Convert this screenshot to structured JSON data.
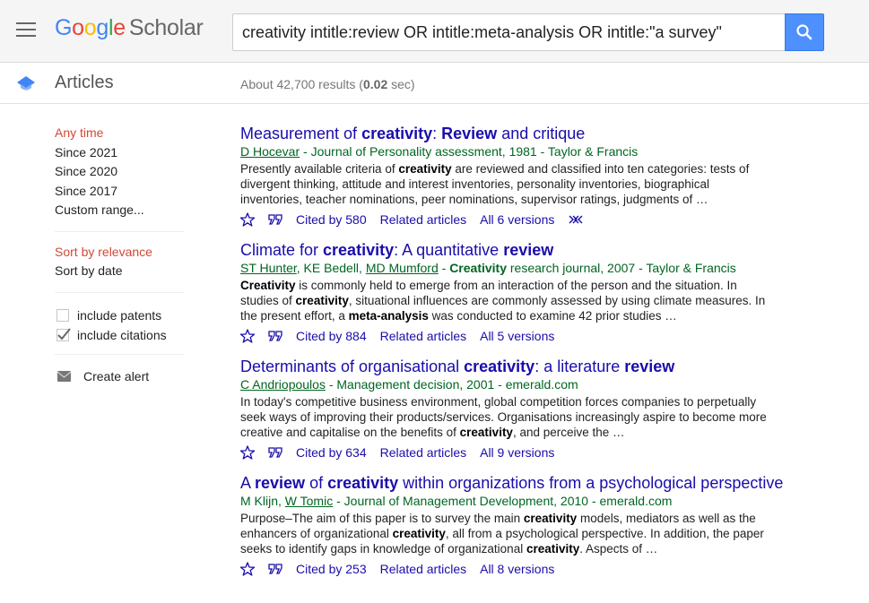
{
  "header": {
    "logo": {
      "google": [
        "G",
        "o",
        "o",
        "g",
        "l",
        "e"
      ],
      "product": "Scholar"
    },
    "search_query": "creativity intitle:review OR intitle:meta-analysis OR intitle:\"a survey\"",
    "search_button_icon": "search-icon",
    "menu_icon": "hamburger-menu-icon"
  },
  "subheader": {
    "section_icon": "graduation-cap-icon",
    "section_label": "Articles",
    "stats_prefix": "About 42,700 results (",
    "stats_time": "0.02",
    "stats_suffix": " sec)"
  },
  "sidebar": {
    "time_filters": [
      {
        "label": "Any time",
        "active": true
      },
      {
        "label": "Since 2021",
        "active": false
      },
      {
        "label": "Since 2020",
        "active": false
      },
      {
        "label": "Since 2017",
        "active": false
      },
      {
        "label": "Custom range...",
        "active": false
      }
    ],
    "sort_options": [
      {
        "label": "Sort by relevance",
        "active": true
      },
      {
        "label": "Sort by date",
        "active": false
      }
    ],
    "checkboxes": [
      {
        "label": "include patents",
        "checked": false
      },
      {
        "label": "include citations",
        "checked": true
      }
    ],
    "create_alert": {
      "label": "Create alert",
      "icon": "envelope-icon"
    }
  },
  "results": [
    {
      "title_parts": [
        {
          "text": "Measurement of ",
          "bold": false
        },
        {
          "text": "creativity",
          "bold": true
        },
        {
          "text": ": ",
          "bold": false
        },
        {
          "text": "Review",
          "bold": true
        },
        {
          "text": " and critique",
          "bold": false
        }
      ],
      "meta_parts": [
        {
          "text": "D Hocevar",
          "link": true
        },
        {
          "text": " - Journal of Personality assessment, 1981 - Taylor & Francis",
          "link": false
        }
      ],
      "snippet_parts": [
        {
          "text": "Presently available criteria of ",
          "bold": false
        },
        {
          "text": "creativity",
          "bold": true
        },
        {
          "text": " are reviewed and classified into ten categories: tests of divergent thinking, attitude and interest inventories, personality inventories, biographical inventories, teacher nominations, peer nominations, supervisor ratings, judgments of …",
          "bold": false
        }
      ],
      "cited_by": "Cited by 580",
      "related": "Related articles",
      "versions": "All 6 versions",
      "has_more": true
    },
    {
      "title_parts": [
        {
          "text": "Climate for ",
          "bold": false
        },
        {
          "text": "creativity",
          "bold": true
        },
        {
          "text": ": A quantitative ",
          "bold": false
        },
        {
          "text": "review",
          "bold": true
        }
      ],
      "meta_parts": [
        {
          "text": "ST Hunter",
          "link": true
        },
        {
          "text": ", KE Bedell, ",
          "link": false
        },
        {
          "text": "MD Mumford",
          "link": true
        },
        {
          "text": " - ",
          "link": false
        },
        {
          "text": "Creativity",
          "link": false,
          "bold": true
        },
        {
          "text": " research journal, 2007 - Taylor & Francis",
          "link": false
        }
      ],
      "snippet_parts": [
        {
          "text": "Creativity",
          "bold": true
        },
        {
          "text": " is commonly held to emerge from an interaction of the person and the situation. In studies of ",
          "bold": false
        },
        {
          "text": "creativity",
          "bold": true
        },
        {
          "text": ", situational influences are commonly assessed by using climate measures. In the present effort, a ",
          "bold": false
        },
        {
          "text": "meta-analysis",
          "bold": true
        },
        {
          "text": " was conducted to examine 42 prior studies …",
          "bold": false
        }
      ],
      "cited_by": "Cited by 884",
      "related": "Related articles",
      "versions": "All 5 versions",
      "has_more": false
    },
    {
      "title_parts": [
        {
          "text": "Determinants of organisational ",
          "bold": false
        },
        {
          "text": "creativity",
          "bold": true
        },
        {
          "text": ": a literature ",
          "bold": false
        },
        {
          "text": "review",
          "bold": true
        }
      ],
      "meta_parts": [
        {
          "text": "C Andriopoulos",
          "link": true
        },
        {
          "text": " - Management decision, 2001 - emerald.com",
          "link": false
        }
      ],
      "snippet_parts": [
        {
          "text": "In today's competitive business environment, global competition forces companies to perpetually seek ways of improving their products/services. Organisations increasingly aspire to become more creative and capitalise on the benefits of ",
          "bold": false
        },
        {
          "text": "creativity",
          "bold": true
        },
        {
          "text": ", and perceive the …",
          "bold": false
        }
      ],
      "cited_by": "Cited by 634",
      "related": "Related articles",
      "versions": "All 9 versions",
      "has_more": false
    },
    {
      "title_parts": [
        {
          "text": "A ",
          "bold": false
        },
        {
          "text": "review",
          "bold": true
        },
        {
          "text": " of ",
          "bold": false
        },
        {
          "text": "creativity",
          "bold": true
        },
        {
          "text": " within organizations from a psychological perspective",
          "bold": false
        }
      ],
      "meta_parts": [
        {
          "text": "M Klijn, ",
          "link": false
        },
        {
          "text": "W Tomic",
          "link": true
        },
        {
          "text": " - Journal of Management Development, 2010 - emerald.com",
          "link": false
        }
      ],
      "snippet_parts": [
        {
          "text": "Purpose–The aim of this paper is to survey the main ",
          "bold": false
        },
        {
          "text": "creativity",
          "bold": true
        },
        {
          "text": " models, mediators as well as the enhancers of organizational ",
          "bold": false
        },
        {
          "text": "creativity",
          "bold": true
        },
        {
          "text": ", all from a psychological perspective. In addition, the paper seeks to identify gaps in knowledge of organizational ",
          "bold": false
        },
        {
          "text": "creativity",
          "bold": true
        },
        {
          "text": ". Aspects of …",
          "bold": false
        }
      ],
      "cited_by": "Cited by 253",
      "related": "Related articles",
      "versions": "All 8 versions",
      "has_more": false
    }
  ],
  "colors": {
    "link": "#1a0dab",
    "meta_green": "#006621",
    "active_red": "#d14836",
    "search_button": "#4d90fe"
  }
}
